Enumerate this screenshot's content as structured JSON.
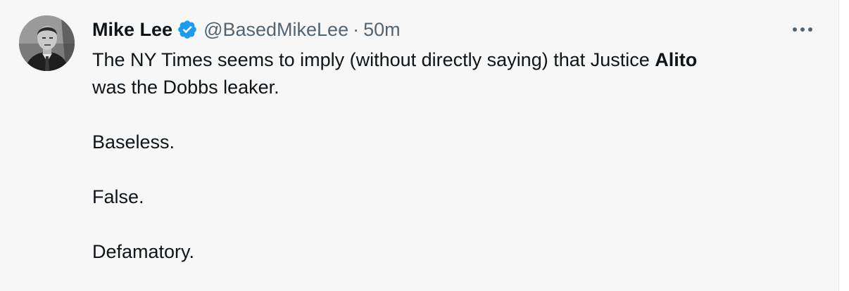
{
  "tweet": {
    "author_name": "Mike Lee",
    "handle": "@BasedMikeLee",
    "separator": "·",
    "time": "50m",
    "more_icon": "more-horizontal-icon",
    "verified_icon": "verified-badge-icon",
    "verified_color": "#1d9bf0",
    "text": {
      "line1_prefix": "The NY Times seems to imply (without directly saying) that Justice ",
      "line1_bold": "Alito",
      "line2": "was the Dobbs leaker.",
      "para2": "Baseless.",
      "para3": "False.",
      "para4": "Defamatory."
    }
  }
}
